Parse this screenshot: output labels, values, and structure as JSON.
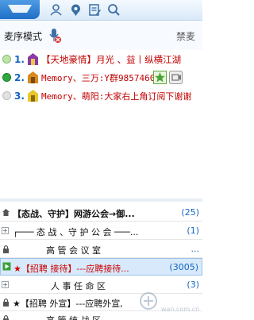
{
  "toolbar": {
    "icons": [
      "queue-tab-icon",
      "user-icon",
      "location-icon",
      "notes-icon",
      "search-icon"
    ]
  },
  "mic_mode": {
    "label": "麦序模式",
    "ban_label": "禁麦"
  },
  "queue": [
    {
      "num": "1.",
      "text": "【天地豪情】月光 、益丨纵横江湖",
      "status_color": "#7ac36a"
    },
    {
      "num": "2.",
      "text": "Memory、三万:Y群9857460",
      "status_color": "#2eaa3c"
    },
    {
      "num": "3.",
      "text": "Memory、萌阳:大家右上角订阅下谢谢",
      "status_color": "#cfcfcf"
    }
  ],
  "tree": [
    {
      "text": "【态战、守护】网游公会→御...",
      "count": "(25)"
    },
    {
      "text": "┌───  态 战 、守 护 公 会 ───...",
      "count": "(1)"
    },
    {
      "text": "高  管  会  议  室",
      "count": "..."
    },
    {
      "text": "★【招聘  接待】---应聘接待...",
      "count": "(3005)"
    },
    {
      "text": "人  事  任  命  区",
      "count": "(3)"
    },
    {
      "text": "★【招聘  外宣】---应聘外宣,",
      "count": ""
    },
    {
      "text": "高  管  统  战  区",
      "count": ""
    }
  ],
  "watermark": {
    "text": "wan.com.cn"
  },
  "colors": {
    "accent": "#1f6fc8",
    "queue_text": "#c00000",
    "selected_bg": "#d7e9fa"
  }
}
